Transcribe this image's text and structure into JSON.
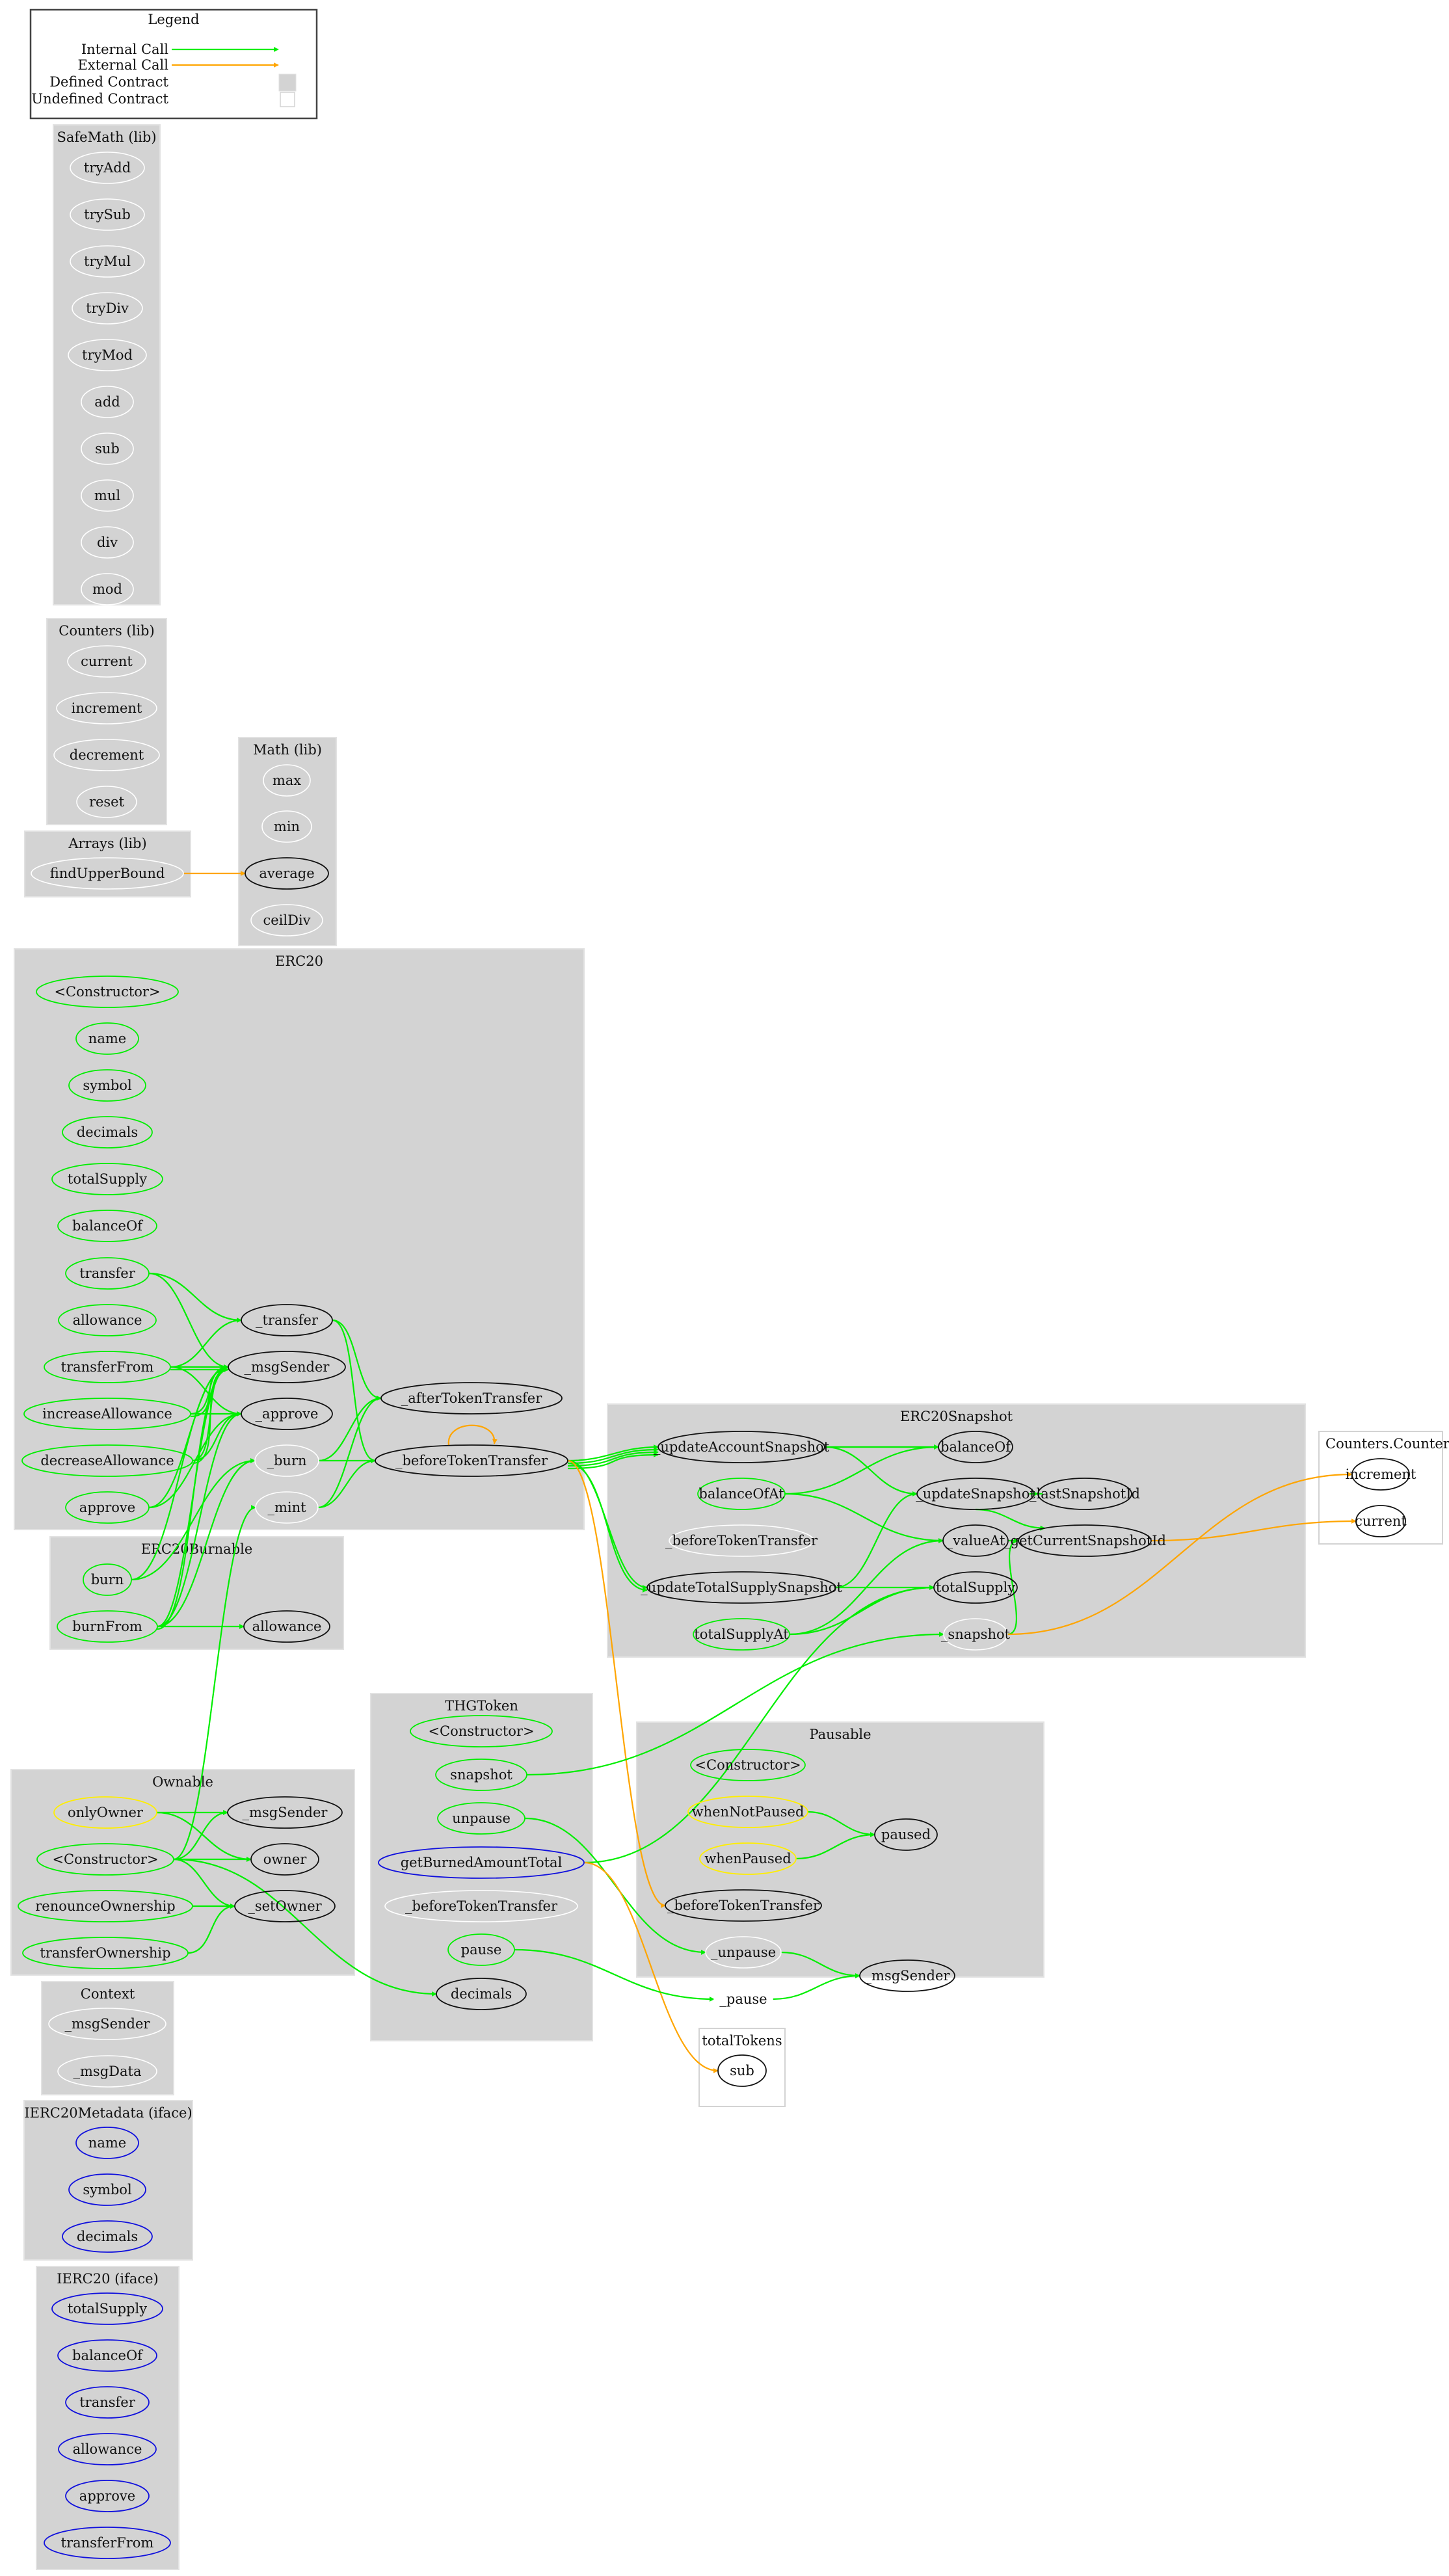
{
  "colors": {
    "internal_call": "#00ee00",
    "external_call": "#ffa500",
    "defined_contract": "#d3d3d3",
    "undefined_contract_border": "#d3d3d3",
    "public_function": "#00ee00",
    "modifier": "#ffee00",
    "interface_function": "#1010dd",
    "internal_function": "#ffffff",
    "external_target": "#111111"
  },
  "legend": {
    "title": "Legend",
    "items": [
      {
        "label": "Internal Call",
        "kind": "internal"
      },
      {
        "label": "External Call",
        "kind": "external"
      },
      {
        "label": "Defined Contract",
        "kind": "defined"
      },
      {
        "label": "Undefined Contract",
        "kind": "undefined"
      }
    ]
  },
  "clusters": [
    {
      "id": "safemath",
      "title": "SafeMath  (lib)",
      "type": "defined",
      "nodes": [
        {
          "id": "sm_tryAdd",
          "label": "tryAdd",
          "style": "internal"
        },
        {
          "id": "sm_trySub",
          "label": "trySub",
          "style": "internal"
        },
        {
          "id": "sm_tryMul",
          "label": "tryMul",
          "style": "internal"
        },
        {
          "id": "sm_tryDiv",
          "label": "tryDiv",
          "style": "internal"
        },
        {
          "id": "sm_tryMod",
          "label": "tryMod",
          "style": "internal"
        },
        {
          "id": "sm_add",
          "label": "add",
          "style": "internal"
        },
        {
          "id": "sm_sub",
          "label": "sub",
          "style": "internal"
        },
        {
          "id": "sm_mul",
          "label": "mul",
          "style": "internal"
        },
        {
          "id": "sm_div",
          "label": "div",
          "style": "internal"
        },
        {
          "id": "sm_mod",
          "label": "mod",
          "style": "internal"
        }
      ]
    },
    {
      "id": "counters",
      "title": "Counters  (lib)",
      "type": "defined",
      "nodes": [
        {
          "id": "ct_current",
          "label": "current",
          "style": "internal"
        },
        {
          "id": "ct_increment",
          "label": "increment",
          "style": "internal"
        },
        {
          "id": "ct_decrement",
          "label": "decrement",
          "style": "internal"
        },
        {
          "id": "ct_reset",
          "label": "reset",
          "style": "internal"
        }
      ]
    },
    {
      "id": "arrays",
      "title": "Arrays  (lib)",
      "type": "defined",
      "nodes": [
        {
          "id": "ar_findUpperBound",
          "label": "findUpperBound",
          "style": "internal"
        }
      ]
    },
    {
      "id": "math",
      "title": "Math  (lib)",
      "type": "defined",
      "nodes": [
        {
          "id": "m_max",
          "label": "max",
          "style": "internal"
        },
        {
          "id": "m_min",
          "label": "min",
          "style": "internal"
        },
        {
          "id": "m_average",
          "label": "average",
          "style": "target"
        },
        {
          "id": "m_ceilDiv",
          "label": "ceilDiv",
          "style": "internal"
        }
      ]
    },
    {
      "id": "erc20",
      "title": "ERC20",
      "type": "defined",
      "nodes": [
        {
          "id": "e_ctor",
          "label": "<Constructor>",
          "style": "public"
        },
        {
          "id": "e_name",
          "label": "name",
          "style": "public"
        },
        {
          "id": "e_symbol",
          "label": "symbol",
          "style": "public"
        },
        {
          "id": "e_decimals",
          "label": "decimals",
          "style": "public"
        },
        {
          "id": "e_totalSupply",
          "label": "totalSupply",
          "style": "public"
        },
        {
          "id": "e_balanceOf",
          "label": "balanceOf",
          "style": "public"
        },
        {
          "id": "e_transfer",
          "label": "transfer",
          "style": "public"
        },
        {
          "id": "e_allowance",
          "label": "allowance",
          "style": "public"
        },
        {
          "id": "e_transferFrom",
          "label": "transferFrom",
          "style": "public"
        },
        {
          "id": "e_increaseAllowance",
          "label": "increaseAllowance",
          "style": "public"
        },
        {
          "id": "e_decreaseAllowance",
          "label": "decreaseAllowance",
          "style": "public"
        },
        {
          "id": "e_approve",
          "label": "approve",
          "style": "public"
        },
        {
          "id": "e__transfer",
          "label": "_transfer",
          "style": "target"
        },
        {
          "id": "e__msgSender",
          "label": "_msgSender",
          "style": "target"
        },
        {
          "id": "e__approve",
          "label": "_approve",
          "style": "target"
        },
        {
          "id": "e__burn",
          "label": "_burn",
          "style": "internal"
        },
        {
          "id": "e__mint",
          "label": "_mint",
          "style": "internal"
        },
        {
          "id": "e__afterTokenTransfer",
          "label": "_afterTokenTransfer",
          "style": "target"
        },
        {
          "id": "e__beforeTokenTransfer",
          "label": "_beforeTokenTransfer",
          "style": "target"
        }
      ]
    },
    {
      "id": "erc20burnable",
      "title": "ERC20Burnable",
      "type": "defined",
      "nodes": [
        {
          "id": "b_burn",
          "label": "burn",
          "style": "public"
        },
        {
          "id": "b_burnFrom",
          "label": "burnFrom",
          "style": "public"
        },
        {
          "id": "b_allowance",
          "label": "allowance",
          "style": "target"
        }
      ]
    },
    {
      "id": "erc20snapshot",
      "title": "ERC20Snapshot",
      "type": "defined",
      "nodes": [
        {
          "id": "s__updateAccountSnapshot",
          "label": "_updateAccountSnapshot",
          "style": "target"
        },
        {
          "id": "s_balanceOfAt",
          "label": "balanceOfAt",
          "style": "public"
        },
        {
          "id": "s__beforeTokenTransfer",
          "label": "_beforeTokenTransfer",
          "style": "internal"
        },
        {
          "id": "s__updateTotalSupplySnapshot",
          "label": "_updateTotalSupplySnapshot",
          "style": "target"
        },
        {
          "id": "s_totalSupplyAt",
          "label": "totalSupplyAt",
          "style": "public"
        },
        {
          "id": "s_balanceOf",
          "label": "balanceOf",
          "style": "target"
        },
        {
          "id": "s__updateSnapshot",
          "label": "_updateSnapshot",
          "style": "target"
        },
        {
          "id": "s__valueAt",
          "label": "_valueAt",
          "style": "target"
        },
        {
          "id": "s_totalSupply",
          "label": "totalSupply",
          "style": "target"
        },
        {
          "id": "s__snapshot",
          "label": "_snapshot",
          "style": "internal"
        },
        {
          "id": "s__lastSnapshotId",
          "label": "_lastSnapshotId",
          "style": "target"
        },
        {
          "id": "s__getCurrentSnapshotId",
          "label": "_getCurrentSnapshotId",
          "style": "target"
        }
      ]
    },
    {
      "id": "counters_counter",
      "title": "Counters.Counter",
      "type": "undefined",
      "nodes": [
        {
          "id": "cc_increment",
          "label": "increment",
          "style": "target"
        },
        {
          "id": "cc_current",
          "label": "current",
          "style": "target"
        }
      ]
    },
    {
      "id": "ownable",
      "title": "Ownable",
      "type": "defined",
      "nodes": [
        {
          "id": "o_onlyOwner",
          "label": "onlyOwner",
          "style": "modifier"
        },
        {
          "id": "o_ctor",
          "label": "<Constructor>",
          "style": "public"
        },
        {
          "id": "o_renounceOwnership",
          "label": "renounceOwnership",
          "style": "public"
        },
        {
          "id": "o_transferOwnership",
          "label": "transferOwnership",
          "style": "public"
        },
        {
          "id": "o__msgSender",
          "label": "_msgSender",
          "style": "target"
        },
        {
          "id": "o_owner",
          "label": "owner",
          "style": "target"
        },
        {
          "id": "o__setOwner",
          "label": "_setOwner",
          "style": "target"
        }
      ]
    },
    {
      "id": "thgtoken",
      "title": "THGToken",
      "type": "defined",
      "nodes": [
        {
          "id": "t_ctor",
          "label": "<Constructor>",
          "style": "public"
        },
        {
          "id": "t_snapshot",
          "label": "snapshot",
          "style": "public"
        },
        {
          "id": "t_unpause",
          "label": "unpause",
          "style": "public"
        },
        {
          "id": "t_getBurnedAmountTotal",
          "label": "getBurnedAmountTotal",
          "style": "interface"
        },
        {
          "id": "t__beforeTokenTransfer",
          "label": "_beforeTokenTransfer",
          "style": "internal"
        },
        {
          "id": "t_pause",
          "label": "pause",
          "style": "public"
        },
        {
          "id": "t_decimals",
          "label": "decimals",
          "style": "target"
        }
      ]
    },
    {
      "id": "pausable",
      "title": "Pausable",
      "type": "defined",
      "nodes": [
        {
          "id": "p_ctor",
          "label": "<Constructor>",
          "style": "public"
        },
        {
          "id": "p_whenNotPaused",
          "label": "whenNotPaused",
          "style": "modifier"
        },
        {
          "id": "p_whenPaused",
          "label": "whenPaused",
          "style": "modifier"
        },
        {
          "id": "p__beforeTokenTransfer",
          "label": "_beforeTokenTransfer",
          "style": "target"
        },
        {
          "id": "p__unpause",
          "label": "_unpause",
          "style": "internal"
        },
        {
          "id": "p__pause",
          "label": "_pause",
          "style": "internal"
        },
        {
          "id": "p_paused",
          "label": "paused",
          "style": "target"
        },
        {
          "id": "p__msgSender",
          "label": "_msgSender",
          "style": "target"
        }
      ]
    },
    {
      "id": "totaltokens",
      "title": "totalTokens",
      "type": "undefined",
      "nodes": [
        {
          "id": "tt_sub",
          "label": "sub",
          "style": "target"
        }
      ]
    },
    {
      "id": "context",
      "title": "Context",
      "type": "defined",
      "nodes": [
        {
          "id": "c__msgSender",
          "label": "_msgSender",
          "style": "internal"
        },
        {
          "id": "c__msgData",
          "label": "_msgData",
          "style": "internal"
        }
      ]
    },
    {
      "id": "ierc20metadata",
      "title": "IERC20Metadata  (iface)",
      "type": "defined",
      "nodes": [
        {
          "id": "im_name",
          "label": "name",
          "style": "interface"
        },
        {
          "id": "im_symbol",
          "label": "symbol",
          "style": "interface"
        },
        {
          "id": "im_decimals",
          "label": "decimals",
          "style": "interface"
        }
      ]
    },
    {
      "id": "ierc20",
      "title": "IERC20  (iface)",
      "type": "defined",
      "nodes": [
        {
          "id": "i_totalSupply",
          "label": "totalSupply",
          "style": "interface"
        },
        {
          "id": "i_balanceOf",
          "label": "balanceOf",
          "style": "interface"
        },
        {
          "id": "i_transfer",
          "label": "transfer",
          "style": "interface"
        },
        {
          "id": "i_allowance",
          "label": "allowance",
          "style": "interface"
        },
        {
          "id": "i_approve",
          "label": "approve",
          "style": "interface"
        },
        {
          "id": "i_transferFrom",
          "label": "transferFrom",
          "style": "interface"
        }
      ]
    }
  ],
  "edges": [
    {
      "from": "ar_findUpperBound",
      "to": "m_average",
      "kind": "external"
    },
    {
      "from": "e_transfer",
      "to": "e__transfer",
      "kind": "internal"
    },
    {
      "from": "e_transfer",
      "to": "e__msgSender",
      "kind": "internal"
    },
    {
      "from": "e_transferFrom",
      "to": "e__transfer",
      "kind": "internal"
    },
    {
      "from": "e_transferFrom",
      "to": "e__msgSender",
      "kind": "internal"
    },
    {
      "from": "e_transferFrom",
      "to": "e__msgSender",
      "kind": "internal"
    },
    {
      "from": "e_transferFrom",
      "to": "e__approve",
      "kind": "internal"
    },
    {
      "from": "e_increaseAllowance",
      "to": "e__msgSender",
      "kind": "internal"
    },
    {
      "from": "e_increaseAllowance",
      "to": "e__msgSender",
      "kind": "internal"
    },
    {
      "from": "e_increaseAllowance",
      "to": "e__approve",
      "kind": "internal"
    },
    {
      "from": "e_decreaseAllowance",
      "to": "e__msgSender",
      "kind": "internal"
    },
    {
      "from": "e_decreaseAllowance",
      "to": "e__msgSender",
      "kind": "internal"
    },
    {
      "from": "e_decreaseAllowance",
      "to": "e__approve",
      "kind": "internal"
    },
    {
      "from": "e_approve",
      "to": "e__msgSender",
      "kind": "internal"
    },
    {
      "from": "e_approve",
      "to": "e__approve",
      "kind": "internal"
    },
    {
      "from": "e__transfer",
      "to": "e__afterTokenTransfer",
      "kind": "internal"
    },
    {
      "from": "e__transfer",
      "to": "e__beforeTokenTransfer",
      "kind": "internal"
    },
    {
      "from": "e__burn",
      "to": "e__afterTokenTransfer",
      "kind": "internal"
    },
    {
      "from": "e__burn",
      "to": "e__beforeTokenTransfer",
      "kind": "internal"
    },
    {
      "from": "e__mint",
      "to": "e__afterTokenTransfer",
      "kind": "internal"
    },
    {
      "from": "e__mint",
      "to": "e__beforeTokenTransfer",
      "kind": "internal"
    },
    {
      "from": "e__beforeTokenTransfer",
      "to": "e__beforeTokenTransfer",
      "kind": "external"
    },
    {
      "from": "e__beforeTokenTransfer",
      "to": "s__updateAccountSnapshot",
      "kind": "internal"
    },
    {
      "from": "e__beforeTokenTransfer",
      "to": "s__updateAccountSnapshot",
      "kind": "internal"
    },
    {
      "from": "e__beforeTokenTransfer",
      "to": "s__updateAccountSnapshot",
      "kind": "internal"
    },
    {
      "from": "e__beforeTokenTransfer",
      "to": "s__updateAccountSnapshot",
      "kind": "internal"
    },
    {
      "from": "e__beforeTokenTransfer",
      "to": "s__updateTotalSupplySnapshot",
      "kind": "internal"
    },
    {
      "from": "e__beforeTokenTransfer",
      "to": "s__updateTotalSupplySnapshot",
      "kind": "internal"
    },
    {
      "from": "e__beforeTokenTransfer",
      "to": "p__beforeTokenTransfer",
      "kind": "external"
    },
    {
      "from": "b_burn",
      "to": "e__msgSender",
      "kind": "internal"
    },
    {
      "from": "b_burn",
      "to": "e__burn",
      "kind": "internal"
    },
    {
      "from": "b_burnFrom",
      "to": "e__msgSender",
      "kind": "internal"
    },
    {
      "from": "b_burnFrom",
      "to": "e__approve",
      "kind": "internal"
    },
    {
      "from": "b_burnFrom",
      "to": "e__msgSender",
      "kind": "internal"
    },
    {
      "from": "b_burnFrom",
      "to": "e__burn",
      "kind": "internal"
    },
    {
      "from": "b_burnFrom",
      "to": "b_allowance",
      "kind": "internal"
    },
    {
      "from": "s__updateAccountSnapshot",
      "to": "s_balanceOf",
      "kind": "internal"
    },
    {
      "from": "s__updateAccountSnapshot",
      "to": "s__updateSnapshot",
      "kind": "internal"
    },
    {
      "from": "s_balanceOfAt",
      "to": "s_balanceOf",
      "kind": "internal"
    },
    {
      "from": "s_balanceOfAt",
      "to": "s__valueAt",
      "kind": "internal"
    },
    {
      "from": "s__updateTotalSupplySnapshot",
      "to": "s__updateSnapshot",
      "kind": "internal"
    },
    {
      "from": "s__updateTotalSupplySnapshot",
      "to": "s_totalSupply",
      "kind": "internal"
    },
    {
      "from": "s_totalSupplyAt",
      "to": "s_totalSupply",
      "kind": "internal"
    },
    {
      "from": "s_totalSupplyAt",
      "to": "s__valueAt",
      "kind": "internal"
    },
    {
      "from": "s__updateSnapshot",
      "to": "s__lastSnapshotId",
      "kind": "internal"
    },
    {
      "from": "s__updateSnapshot",
      "to": "s__getCurrentSnapshotId",
      "kind": "internal"
    },
    {
      "from": "s__valueAt",
      "to": "s__getCurrentSnapshotId",
      "kind": "internal"
    },
    {
      "from": "s__snapshot",
      "to": "s__getCurrentSnapshotId",
      "kind": "internal"
    },
    {
      "from": "s__snapshot",
      "to": "cc_increment",
      "kind": "external"
    },
    {
      "from": "s__getCurrentSnapshotId",
      "to": "cc_current",
      "kind": "external"
    },
    {
      "from": "o_onlyOwner",
      "to": "o__msgSender",
      "kind": "internal"
    },
    {
      "from": "o_onlyOwner",
      "to": "o_owner",
      "kind": "internal"
    },
    {
      "from": "o_ctor",
      "to": "o__msgSender",
      "kind": "internal"
    },
    {
      "from": "o_ctor",
      "to": "o_owner",
      "kind": "internal"
    },
    {
      "from": "o_ctor",
      "to": "o__setOwner",
      "kind": "internal"
    },
    {
      "from": "o_ctor",
      "to": "e__mint",
      "kind": "internal"
    },
    {
      "from": "o_ctor",
      "to": "t_decimals",
      "kind": "internal"
    },
    {
      "from": "o_renounceOwnership",
      "to": "o__setOwner",
      "kind": "internal"
    },
    {
      "from": "o_transferOwnership",
      "to": "o__setOwner",
      "kind": "internal"
    },
    {
      "from": "t_snapshot",
      "to": "s__snapshot",
      "kind": "internal"
    },
    {
      "from": "t_unpause",
      "to": "p__unpause",
      "kind": "internal"
    },
    {
      "from": "t_getBurnedAmountTotal",
      "to": "s_totalSupply",
      "kind": "internal"
    },
    {
      "from": "t_getBurnedAmountTotal",
      "to": "tt_sub",
      "kind": "external"
    },
    {
      "from": "t_pause",
      "to": "p__pause",
      "kind": "internal"
    },
    {
      "from": "p_whenNotPaused",
      "to": "p_paused",
      "kind": "internal"
    },
    {
      "from": "p_whenPaused",
      "to": "p_paused",
      "kind": "internal"
    },
    {
      "from": "p__unpause",
      "to": "p__msgSender",
      "kind": "internal"
    },
    {
      "from": "p__pause",
      "to": "p__msgSender",
      "kind": "internal"
    }
  ]
}
